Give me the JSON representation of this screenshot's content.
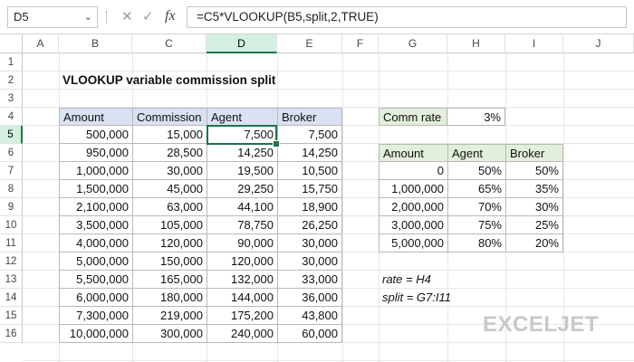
{
  "name_box": "D5",
  "formula": "=C5*VLOOKUP(B5,split,2,TRUE)",
  "columns": [
    "A",
    "B",
    "C",
    "D",
    "E",
    "F",
    "G",
    "H",
    "I",
    "J"
  ],
  "rows": [
    "1",
    "2",
    "3",
    "4",
    "5",
    "6",
    "7",
    "8",
    "9",
    "10",
    "11",
    "12",
    "13",
    "14",
    "15",
    "16"
  ],
  "title": "VLOOKUP variable commission split",
  "main_table": {
    "headers": [
      "Amount",
      "Commission",
      "Agent",
      "Broker"
    ],
    "rows": [
      [
        "500,000",
        "15,000",
        "7,500",
        "7,500"
      ],
      [
        "950,000",
        "28,500",
        "14,250",
        "14,250"
      ],
      [
        "1,000,000",
        "30,000",
        "19,500",
        "10,500"
      ],
      [
        "1,500,000",
        "45,000",
        "29,250",
        "15,750"
      ],
      [
        "2,100,000",
        "63,000",
        "44,100",
        "18,900"
      ],
      [
        "3,500,000",
        "105,000",
        "78,750",
        "26,250"
      ],
      [
        "4,000,000",
        "120,000",
        "90,000",
        "30,000"
      ],
      [
        "5,000,000",
        "150,000",
        "120,000",
        "30,000"
      ],
      [
        "5,500,000",
        "165,000",
        "132,000",
        "33,000"
      ],
      [
        "6,000,000",
        "180,000",
        "144,000",
        "36,000"
      ],
      [
        "7,300,000",
        "219,000",
        "175,200",
        "43,800"
      ],
      [
        "10,000,000",
        "300,000",
        "240,000",
        "60,000"
      ]
    ]
  },
  "comm_rate": {
    "label": "Comm rate",
    "value": "3%"
  },
  "split_table": {
    "headers": [
      "Amount",
      "Agent",
      "Broker"
    ],
    "rows": [
      [
        "0",
        "50%",
        "50%"
      ],
      [
        "1,000,000",
        "65%",
        "35%"
      ],
      [
        "2,000,000",
        "70%",
        "30%"
      ],
      [
        "3,000,000",
        "75%",
        "25%"
      ],
      [
        "5,000,000",
        "80%",
        "20%"
      ]
    ]
  },
  "notes": [
    "rate = H4",
    "split = G7:I11"
  ],
  "logo": "EXCELJET",
  "colors": {
    "accent": "#217346",
    "header_blue": "#d9e1f2",
    "header_green": "#e2efda"
  }
}
